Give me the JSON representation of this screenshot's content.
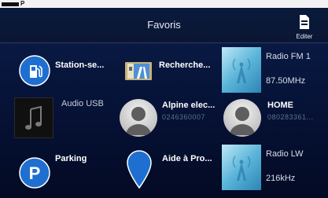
{
  "header": {
    "title": "Favoris",
    "edit_label": "Editer"
  },
  "favorites": [
    {
      "label": "Station-se...",
      "icon": "fuel-station-icon"
    },
    {
      "label": "Recherche...",
      "icon": "map-search-icon"
    },
    {
      "label": "Radio FM 1",
      "frequency": "87.50MHz",
      "icon": "radio-antenna-icon"
    },
    {
      "label": "Audio USB",
      "icon": "music-note-icon"
    },
    {
      "label": "Alpine elec...",
      "phone": "0246360007",
      "icon": "contact-avatar-icon"
    },
    {
      "label": "HOME",
      "phone": "080283361...",
      "icon": "contact-avatar-icon"
    },
    {
      "label": "Parking",
      "icon": "parking-icon"
    },
    {
      "label": "Aide à Pro...",
      "icon": "map-pin-icon"
    },
    {
      "label": "Radio LW",
      "frequency": "216kHz",
      "icon": "radio-antenna-icon"
    }
  ]
}
